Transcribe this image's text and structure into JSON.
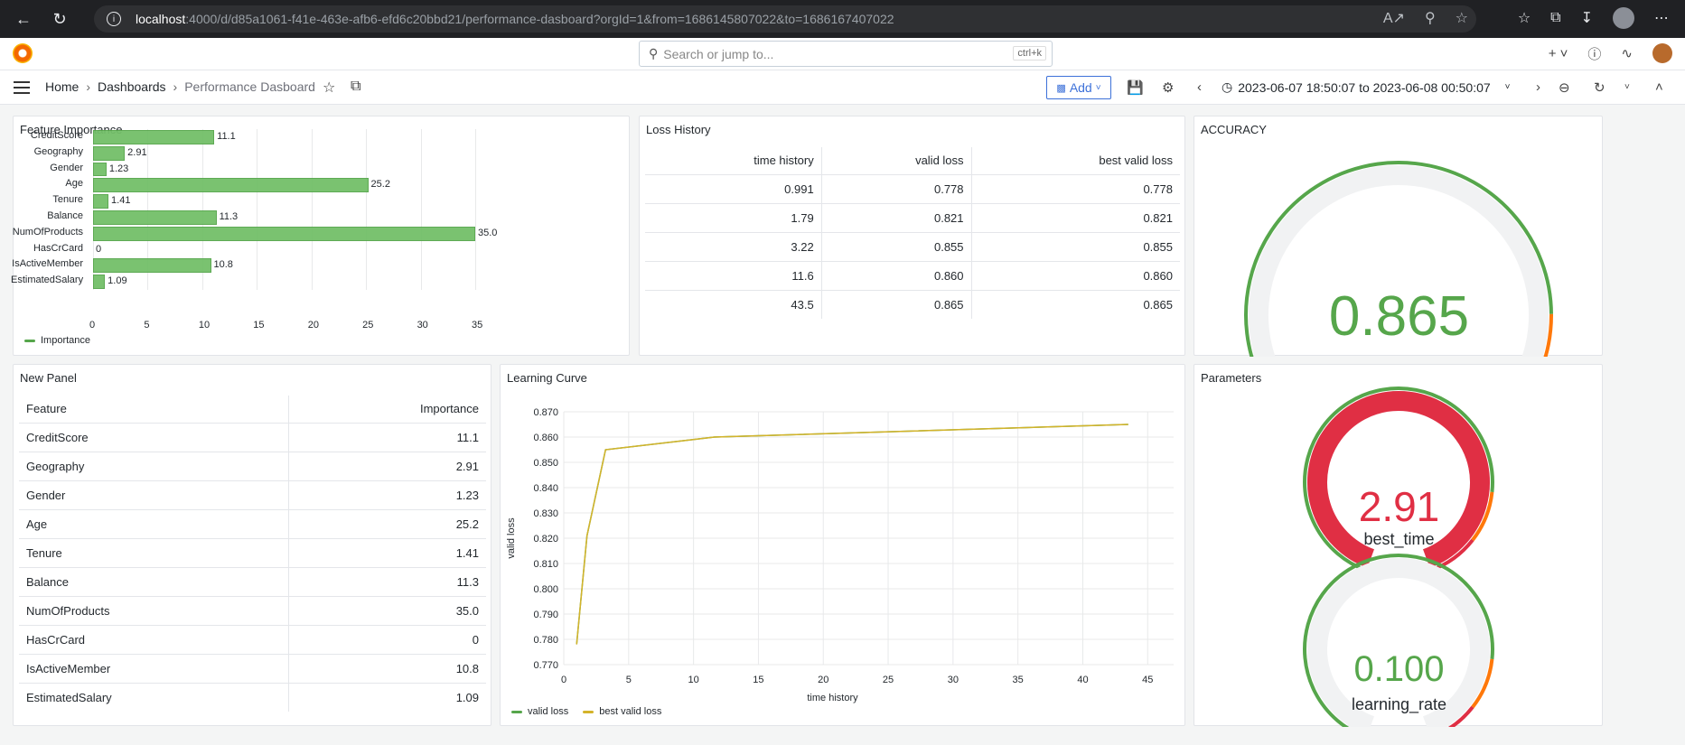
{
  "browser": {
    "url_host": "localhost",
    "url_rest": ":4000/d/d85a1061-f41e-463e-afb6-efd6c20bbd21/performance-dasboard?orgId=1&from=1686145807022&to=1686167407022"
  },
  "topnav": {
    "search_placeholder": "Search or jump to...",
    "search_shortcut": "ctrl+k"
  },
  "dashnav": {
    "breadcrumb_home": "Home",
    "breadcrumb_dashboards": "Dashboards",
    "breadcrumb_current": "Performance Dasboard",
    "add_label": "Add",
    "time_range": "2023-06-07 18:50:07 to 2023-06-08 00:50:07"
  },
  "panels": {
    "feature_importance": {
      "title": "Feature Importance",
      "legend": "Importance"
    },
    "loss_history": {
      "title": "Loss History",
      "columns": [
        "time history",
        "valid loss",
        "best valid loss"
      ],
      "rows": [
        [
          "0.991",
          "0.778",
          "0.778"
        ],
        [
          "1.79",
          "0.821",
          "0.821"
        ],
        [
          "3.22",
          "0.855",
          "0.855"
        ],
        [
          "11.6",
          "0.860",
          "0.860"
        ],
        [
          "43.5",
          "0.865",
          "0.865"
        ]
      ]
    },
    "accuracy": {
      "title": "ACCURACY",
      "value": "0.865",
      "fraction": 0.865
    },
    "new_panel": {
      "title": "New Panel",
      "columns": [
        "Feature",
        "Importance"
      ],
      "rows": [
        [
          "CreditScore",
          "11.1"
        ],
        [
          "Geography",
          "2.91"
        ],
        [
          "Gender",
          "1.23"
        ],
        [
          "Age",
          "25.2"
        ],
        [
          "Tenure",
          "1.41"
        ],
        [
          "Balance",
          "11.3"
        ],
        [
          "NumOfProducts",
          "35.0"
        ],
        [
          "HasCrCard",
          "0"
        ],
        [
          "IsActiveMember",
          "10.8"
        ],
        [
          "EstimatedSalary",
          "1.09"
        ]
      ]
    },
    "learning_curve": {
      "title": "Learning Curve",
      "xlabel": "time history",
      "ylabel": "valid loss",
      "legend": [
        "valid loss",
        "best valid loss"
      ]
    },
    "parameters": {
      "title": "Parameters",
      "best_time_value": "2.91",
      "best_time_name": "best_time",
      "learning_rate_value": "0.100",
      "learning_rate_name": "learning_rate"
    }
  },
  "colors": {
    "green": "#56a64b",
    "bar_green": "#73bf69",
    "red": "#e02f44",
    "orange": "#ff780a",
    "yellow_line": "#d4b32a",
    "accent_blue": "#3d71d9"
  },
  "chart_data": [
    {
      "type": "bar",
      "orientation": "horizontal",
      "title": "Feature Importance",
      "categories": [
        "CreditScore",
        "Geography",
        "Gender",
        "Age",
        "Tenure",
        "Balance",
        "NumOfProducts",
        "HasCrCard",
        "IsActiveMember",
        "EstimatedSalary"
      ],
      "values": [
        11.1,
        2.91,
        1.23,
        25.2,
        1.41,
        11.3,
        35.0,
        0,
        10.8,
        1.09
      ],
      "value_labels": [
        "11.1",
        "2.91",
        "1.23",
        "25.2",
        "1.41",
        "11.3",
        "35.0",
        "0",
        "10.8",
        "1.09"
      ],
      "series_name": "Importance",
      "xlim": [
        0,
        35
      ],
      "xticks": [
        0,
        5,
        10,
        15,
        20,
        25,
        30,
        35
      ],
      "grid": true,
      "legend": "bottom-left"
    },
    {
      "type": "line",
      "title": "Learning Curve",
      "xlabel": "time history",
      "ylabel": "valid loss",
      "x": [
        0.991,
        1.79,
        3.22,
        11.6,
        43.5
      ],
      "series": [
        {
          "name": "valid loss",
          "values": [
            0.778,
            0.821,
            0.855,
            0.86,
            0.865
          ]
        },
        {
          "name": "best valid loss",
          "values": [
            0.778,
            0.821,
            0.855,
            0.86,
            0.865
          ]
        }
      ],
      "xlim": [
        0,
        47
      ],
      "ylim": [
        0.77,
        0.87
      ],
      "xticks": [
        0,
        5,
        10,
        15,
        20,
        25,
        30,
        35,
        40,
        45
      ],
      "yticks": [
        "0.770",
        "0.780",
        "0.790",
        "0.800",
        "0.810",
        "0.820",
        "0.830",
        "0.840",
        "0.850",
        "0.860",
        "0.870"
      ],
      "grid": true,
      "legend": "bottom-left"
    }
  ]
}
